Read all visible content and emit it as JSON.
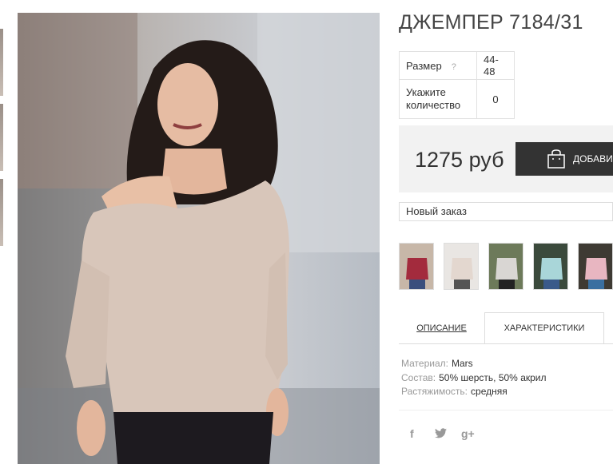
{
  "product": {
    "title": "ДЖЕМПЕР 7184/31",
    "size_label": "Размер",
    "size_help": "?",
    "size_value": "44-48",
    "qty_label": "Укажите количество",
    "qty_value": "0",
    "price": "1275 руб",
    "add_button": "ДОБАВИТЬ"
  },
  "order_select": {
    "value": "Новый заказ"
  },
  "color_thumbnails": [
    {
      "name": "burgundy",
      "color": "#a32b3d"
    },
    {
      "name": "beige",
      "color": "#e3d7cf"
    },
    {
      "name": "light-grey",
      "color": "#d9d6d3"
    },
    {
      "name": "mint",
      "color": "#a9d6d9"
    },
    {
      "name": "pink",
      "color": "#e8b6c1"
    }
  ],
  "tabs": {
    "description": "ОПИСАНИЕ",
    "characteristics": "ХАРАКТЕРИСТИКИ"
  },
  "specs": [
    {
      "key": "Материал:",
      "value": "Mars"
    },
    {
      "key": "Состав:",
      "value": "50% шерсть, 50% акрил"
    },
    {
      "key": "Растяжимость:",
      "value": "средняя"
    }
  ],
  "social": {
    "facebook": "f",
    "twitter": "twitter-icon",
    "gplus": "g+"
  }
}
